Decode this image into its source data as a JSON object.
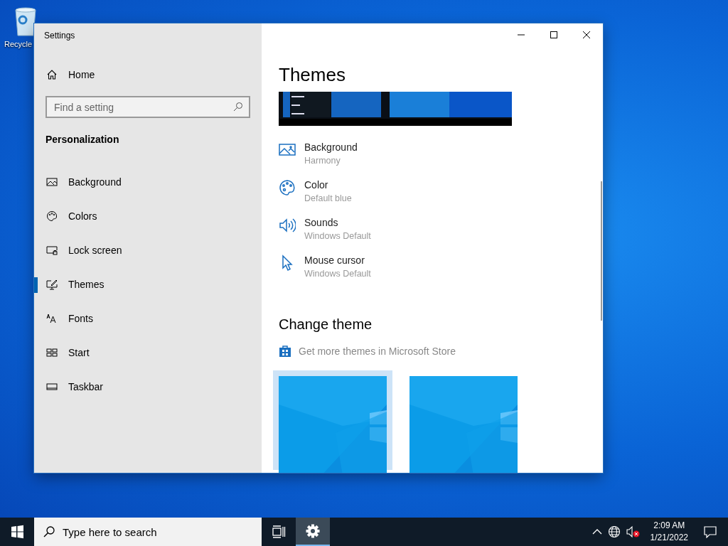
{
  "desktop": {
    "icons": [
      {
        "label": "Recycle"
      }
    ]
  },
  "window": {
    "title": "Settings"
  },
  "sidebar": {
    "home": "Home",
    "search": {
      "placeholder": "Find a setting"
    },
    "section": "Personalization",
    "items": [
      {
        "kind": "background",
        "label": "Background",
        "selected": false
      },
      {
        "kind": "colors",
        "label": "Colors",
        "selected": false
      },
      {
        "kind": "lock",
        "label": "Lock screen",
        "selected": false
      },
      {
        "kind": "themes",
        "label": "Themes",
        "selected": true
      },
      {
        "kind": "fonts",
        "label": "Fonts",
        "selected": false
      },
      {
        "kind": "start",
        "label": "Start",
        "selected": false
      },
      {
        "kind": "taskbar",
        "label": "Taskbar",
        "selected": false
      }
    ]
  },
  "content": {
    "title": "Themes",
    "settings": [
      {
        "kind": "background",
        "label": "Background",
        "value": "Harmony"
      },
      {
        "kind": "color",
        "label": "Color",
        "value": "Default blue"
      },
      {
        "kind": "sounds",
        "label": "Sounds",
        "value": "Windows Default"
      },
      {
        "kind": "cursor",
        "label": "Mouse cursor",
        "value": "Windows Default"
      }
    ],
    "change_theme": {
      "heading": "Change theme",
      "store_link": "Get more themes in Microsoft Store",
      "themes": [
        {
          "selected": true
        },
        {
          "selected": false
        }
      ]
    }
  },
  "taskbar": {
    "search": {
      "placeholder": "Type here to search"
    },
    "apps": [
      {
        "kind": "taskview",
        "active": false
      },
      {
        "kind": "settings",
        "active": true
      }
    ],
    "clock": {
      "time": "2:09 AM",
      "date": "1/21/2022"
    }
  }
}
